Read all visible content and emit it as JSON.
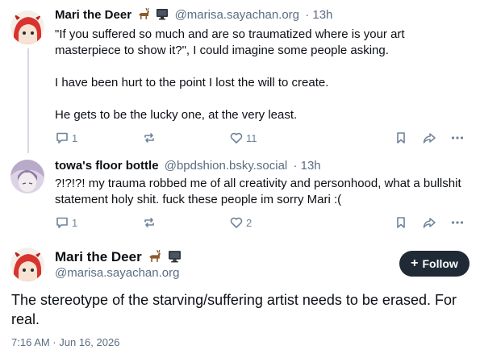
{
  "posts": [
    {
      "author": "Mari the Deer",
      "badges": [
        "deer-emoji",
        "computer-emoji"
      ],
      "handle": "@marisa.sayachan.org",
      "time": "· 13h",
      "paragraphs": [
        "\"If you suffered so much and are so traumatized where is your art masterpiece to show it?\", I could imagine some people asking.",
        "I have been hurt to the point I lost the will to create.",
        "He gets to be the lucky one, at the very least."
      ],
      "replies": "1",
      "reposts": "",
      "likes": "11"
    },
    {
      "author": "towa's floor bottle",
      "handle": "@bpdshion.bsky.social",
      "time": "· 13h",
      "paragraphs": [
        "?!?!?! my trauma robbed me of all creativity and personhood, what a bullshit statement holy shit. fuck these people im sorry Mari :("
      ],
      "replies": "1",
      "reposts": "",
      "likes": "2"
    }
  ],
  "main_post": {
    "author": "Mari the Deer",
    "badges": [
      "deer-emoji",
      "computer-emoji"
    ],
    "handle": "@marisa.sayachan.org",
    "follow_label": "Follow",
    "text": "The stereotype of the starving/suffering artist needs to be erased. For real.",
    "timestamp": "7:16 AM · Jun 16, 2026"
  },
  "colors": {
    "text": "#0b0f14",
    "muted": "#5b6d82",
    "icon": "#6f839a",
    "follow_bg": "#1f2a36",
    "thread_line": "#d4dbe2"
  }
}
